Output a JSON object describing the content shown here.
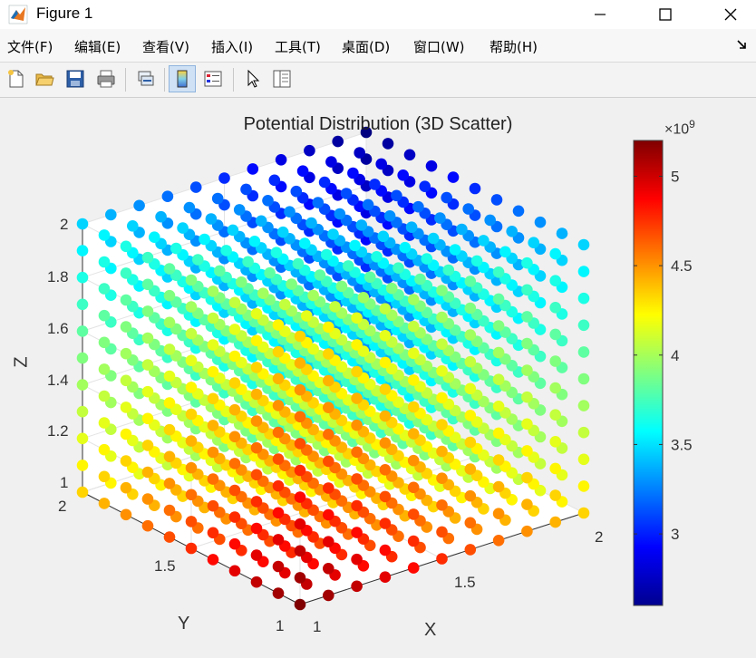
{
  "window": {
    "title": "Figure 1"
  },
  "menu": [
    "文件(F)",
    "编辑(E)",
    "查看(V)",
    "插入(I)",
    "工具(T)",
    "桌面(D)",
    "窗口(W)",
    "帮助(H)"
  ],
  "toolbar": [
    "new-figure",
    "open-file",
    "save",
    "print",
    "link-plot",
    "insert-colorbar",
    "insert-legend",
    "edit-plot",
    "property-inspector"
  ],
  "chart_data": {
    "type": "scatter3d",
    "title": "Potential Distribution (3D Scatter)",
    "xlabel": "X",
    "ylabel": "Y",
    "zlabel": "Z",
    "x_grid": [
      1,
      1.1,
      1.2,
      1.3,
      1.4,
      1.5,
      1.6,
      1.7,
      1.8,
      1.9,
      2
    ],
    "y_grid": [
      1,
      1.1,
      1.2,
      1.3,
      1.4,
      1.5,
      1.6,
      1.7,
      1.8,
      1.9,
      2
    ],
    "z_grid": [
      1,
      1.1,
      1.2,
      1.3,
      1.4,
      1.5,
      1.6,
      1.7,
      1.8,
      1.9,
      2
    ],
    "xlim": [
      1,
      2
    ],
    "ylim": [
      1,
      2
    ],
    "zlim": [
      1,
      2
    ],
    "x_ticks": [
      "1",
      "1.5",
      "2"
    ],
    "y_ticks": [
      "1",
      "1.5",
      "2"
    ],
    "z_ticks": [
      "1",
      "1.2",
      "1.4",
      "1.6",
      "1.8",
      "2"
    ],
    "color_scale": {
      "multiplier": "×10",
      "exponent": "9",
      "min": 2.6,
      "max": 5.2,
      "ticks": [
        "3",
        "3.5",
        "4",
        "4.5",
        "5"
      ],
      "colormap": "jet"
    },
    "potential_range": {
      "at_1_1_1": 5.2,
      "at_2_2_2": 2.6
    }
  }
}
